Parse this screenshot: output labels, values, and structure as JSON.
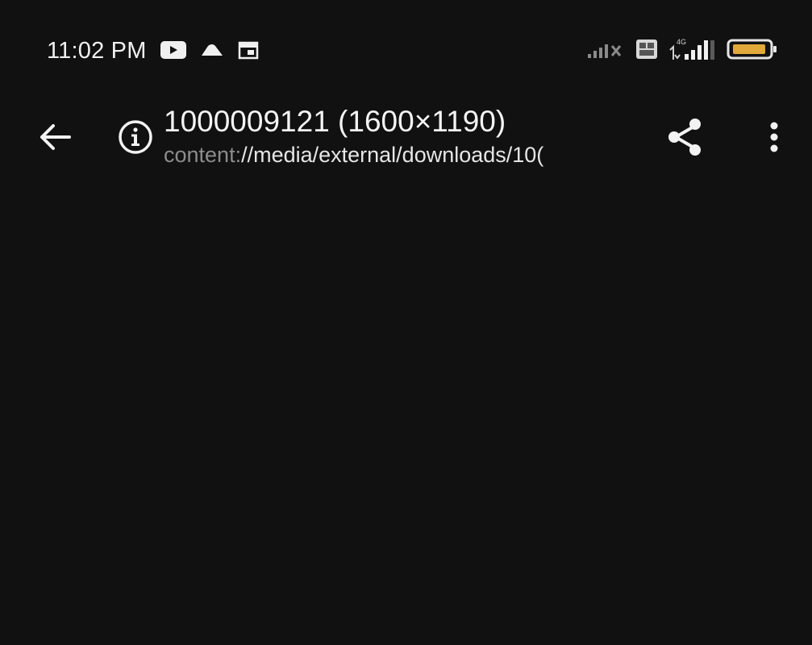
{
  "status_bar": {
    "time": "11:02 PM",
    "notification_icons": [
      "youtube-icon",
      "cloud-icon",
      "calendar-icon"
    ],
    "right_icons": [
      "signal-weak-icon",
      "volte-icon",
      "signal-4g-icon",
      "battery-icon"
    ],
    "network_label": "4G",
    "battery_color": "#e0a93a"
  },
  "app_bar": {
    "title": "1000009121 (1600×1190)",
    "subtitle_scheme": "content:",
    "subtitle_path": "//media/external/downloads/10("
  },
  "colors": {
    "background": "#111111",
    "text_primary": "#f4f4f4",
    "text_scheme": "#8c8c8c"
  }
}
